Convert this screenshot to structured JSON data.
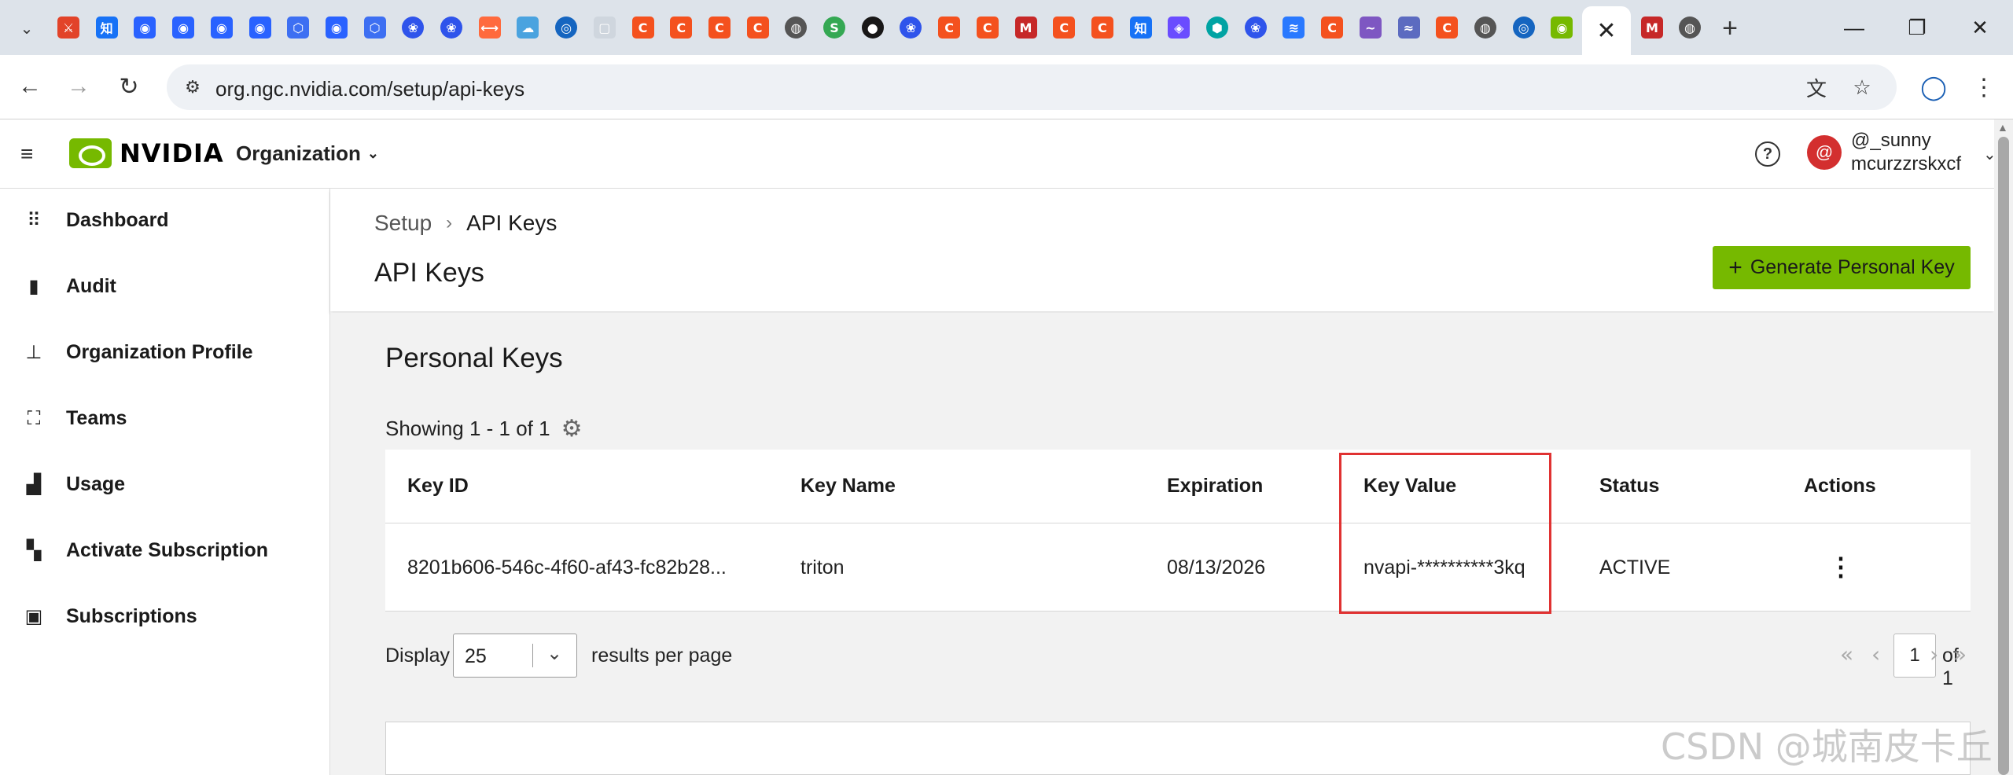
{
  "browser": {
    "tabs": [
      {
        "glyph": "⚔",
        "bg": "#e24329",
        "shape": "square"
      },
      {
        "glyph": "知",
        "bg": "#1772f6",
        "shape": "square"
      },
      {
        "glyph": "◉",
        "bg": "#2962ff",
        "shape": "square"
      },
      {
        "glyph": "◉",
        "bg": "#2962ff",
        "shape": "square"
      },
      {
        "glyph": "◉",
        "bg": "#2962ff",
        "shape": "square"
      },
      {
        "glyph": "◉",
        "bg": "#2962ff",
        "shape": "square"
      },
      {
        "glyph": "⬡",
        "bg": "#3d6ff2",
        "shape": "square"
      },
      {
        "glyph": "◉",
        "bg": "#2962ff",
        "shape": "square"
      },
      {
        "glyph": "⬡",
        "bg": "#3d6ff2",
        "shape": "square"
      },
      {
        "glyph": "❀",
        "bg": "#2f54eb",
        "shape": "circle"
      },
      {
        "glyph": "❀",
        "bg": "#2f54eb",
        "shape": "circle"
      },
      {
        "glyph": "⟷",
        "bg": "#ff6a3d",
        "shape": "square"
      },
      {
        "glyph": "☁",
        "bg": "#4aa3df",
        "shape": "square"
      },
      {
        "glyph": "◎",
        "bg": "#1565c0",
        "shape": "circle"
      },
      {
        "glyph": "▢",
        "bg": "#cfd6de",
        "shape": "square"
      },
      {
        "glyph": "C",
        "bg": "#f4511e",
        "shape": "square"
      },
      {
        "glyph": "C",
        "bg": "#f4511e",
        "shape": "square"
      },
      {
        "glyph": "C",
        "bg": "#f4511e",
        "shape": "square"
      },
      {
        "glyph": "C",
        "bg": "#f4511e",
        "shape": "square"
      },
      {
        "glyph": "◍",
        "bg": "#555555",
        "shape": "circle"
      },
      {
        "glyph": "S",
        "bg": "#34a853",
        "shape": "circle"
      },
      {
        "glyph": "●",
        "bg": "#181717",
        "shape": "circle"
      },
      {
        "glyph": "❀",
        "bg": "#2f54eb",
        "shape": "circle"
      },
      {
        "glyph": "C",
        "bg": "#f4511e",
        "shape": "square"
      },
      {
        "glyph": "C",
        "bg": "#f4511e",
        "shape": "square"
      },
      {
        "glyph": "M",
        "bg": "#c62828",
        "shape": "square"
      },
      {
        "glyph": "C",
        "bg": "#f4511e",
        "shape": "square"
      },
      {
        "glyph": "C",
        "bg": "#f4511e",
        "shape": "square"
      },
      {
        "glyph": "知",
        "bg": "#1772f6",
        "shape": "square"
      },
      {
        "glyph": "◈",
        "bg": "#6a4cff",
        "shape": "square"
      },
      {
        "glyph": "⬢",
        "bg": "#00a3a3",
        "shape": "circle"
      },
      {
        "glyph": "❀",
        "bg": "#2f54eb",
        "shape": "circle"
      },
      {
        "glyph": "≋",
        "bg": "#2979ff",
        "shape": "square"
      },
      {
        "glyph": "C",
        "bg": "#f4511e",
        "shape": "square"
      },
      {
        "glyph": "~",
        "bg": "#7e57c2",
        "shape": "square"
      },
      {
        "glyph": "≈",
        "bg": "#5c6bc0",
        "shape": "square"
      },
      {
        "glyph": "C",
        "bg": "#f4511e",
        "shape": "square"
      },
      {
        "glyph": "◍",
        "bg": "#555555",
        "shape": "circle"
      },
      {
        "glyph": "◎",
        "bg": "#1565c0",
        "shape": "circle"
      },
      {
        "glyph": "◉",
        "bg": "#76b900",
        "shape": "square"
      }
    ],
    "after_tabs": [
      {
        "glyph": "M",
        "bg": "#c62828",
        "shape": "square"
      },
      {
        "glyph": "◍",
        "bg": "#555555",
        "shape": "circle"
      }
    ],
    "active_tab_close": "✕",
    "new_tab": "+",
    "url": "org.ngc.nvidia.com/setup/api-keys",
    "icons": {
      "back": "←",
      "forward": "→",
      "reload": "↻",
      "site_info": "⚙",
      "translate": "文",
      "star": "☆",
      "profile": "◯",
      "menu": "⋮",
      "minimize": "—",
      "restore": "❐",
      "close": "✕",
      "tab_search": "⌄"
    }
  },
  "header": {
    "brand": "NVIDIA",
    "org_menu": "Organization",
    "org_caret": "⌄",
    "help": "?",
    "avatar_initial": "@",
    "user_name": "@_sunny",
    "user_org": "mcurzzrskxcf",
    "user_caret": "⌄",
    "hamburger": "≡"
  },
  "sidebar": {
    "items": [
      {
        "label": "Dashboard",
        "icon": "⠿",
        "icon_name": "grid-icon"
      },
      {
        "label": "Audit",
        "icon": "▮",
        "icon_name": "clipboard-icon"
      },
      {
        "label": "Organization Profile",
        "icon": "⊥",
        "icon_name": "hierarchy-icon"
      },
      {
        "label": "Teams",
        "icon": "⛶",
        "icon_name": "teams-icon"
      },
      {
        "label": "Usage",
        "icon": "▟",
        "icon_name": "bar-chart-icon"
      },
      {
        "label": "Activate Subscription",
        "icon": "▚",
        "icon_name": "widgets-icon"
      },
      {
        "label": "Subscriptions",
        "icon": "▣",
        "icon_name": "subscription-icon"
      }
    ]
  },
  "page": {
    "breadcrumb_parent": "Setup",
    "breadcrumb_sep": "›",
    "breadcrumb_current": "API Keys",
    "title": "API Keys",
    "generate_button": "Generate Personal Key",
    "generate_button_icon": "+",
    "accent": "#76b900"
  },
  "keys": {
    "section_title": "Personal Keys",
    "showing": "Showing 1 - 1 of 1",
    "columns": {
      "key_id": "Key ID",
      "key_name": "Key Name",
      "expiration": "Expiration",
      "key_value": "Key Value",
      "status": "Status",
      "actions": "Actions"
    },
    "rows": [
      {
        "key_id": "8201b606-546c-4f60-af43-fc82b28...",
        "key_name": "triton",
        "expiration": "08/13/2026",
        "key_value": "nvapi-**********3kq",
        "status": "ACTIVE",
        "actions_icon": "⋮"
      }
    ],
    "highlight_color": "#e03232"
  },
  "pagination": {
    "display_label": "Display",
    "per_page": "25",
    "results_label": "results per page",
    "page": "1",
    "of_label": "of 1",
    "first": "«",
    "prev": "‹",
    "next": "›",
    "last": "»"
  },
  "watermark": "CSDN @城南皮卡丘"
}
